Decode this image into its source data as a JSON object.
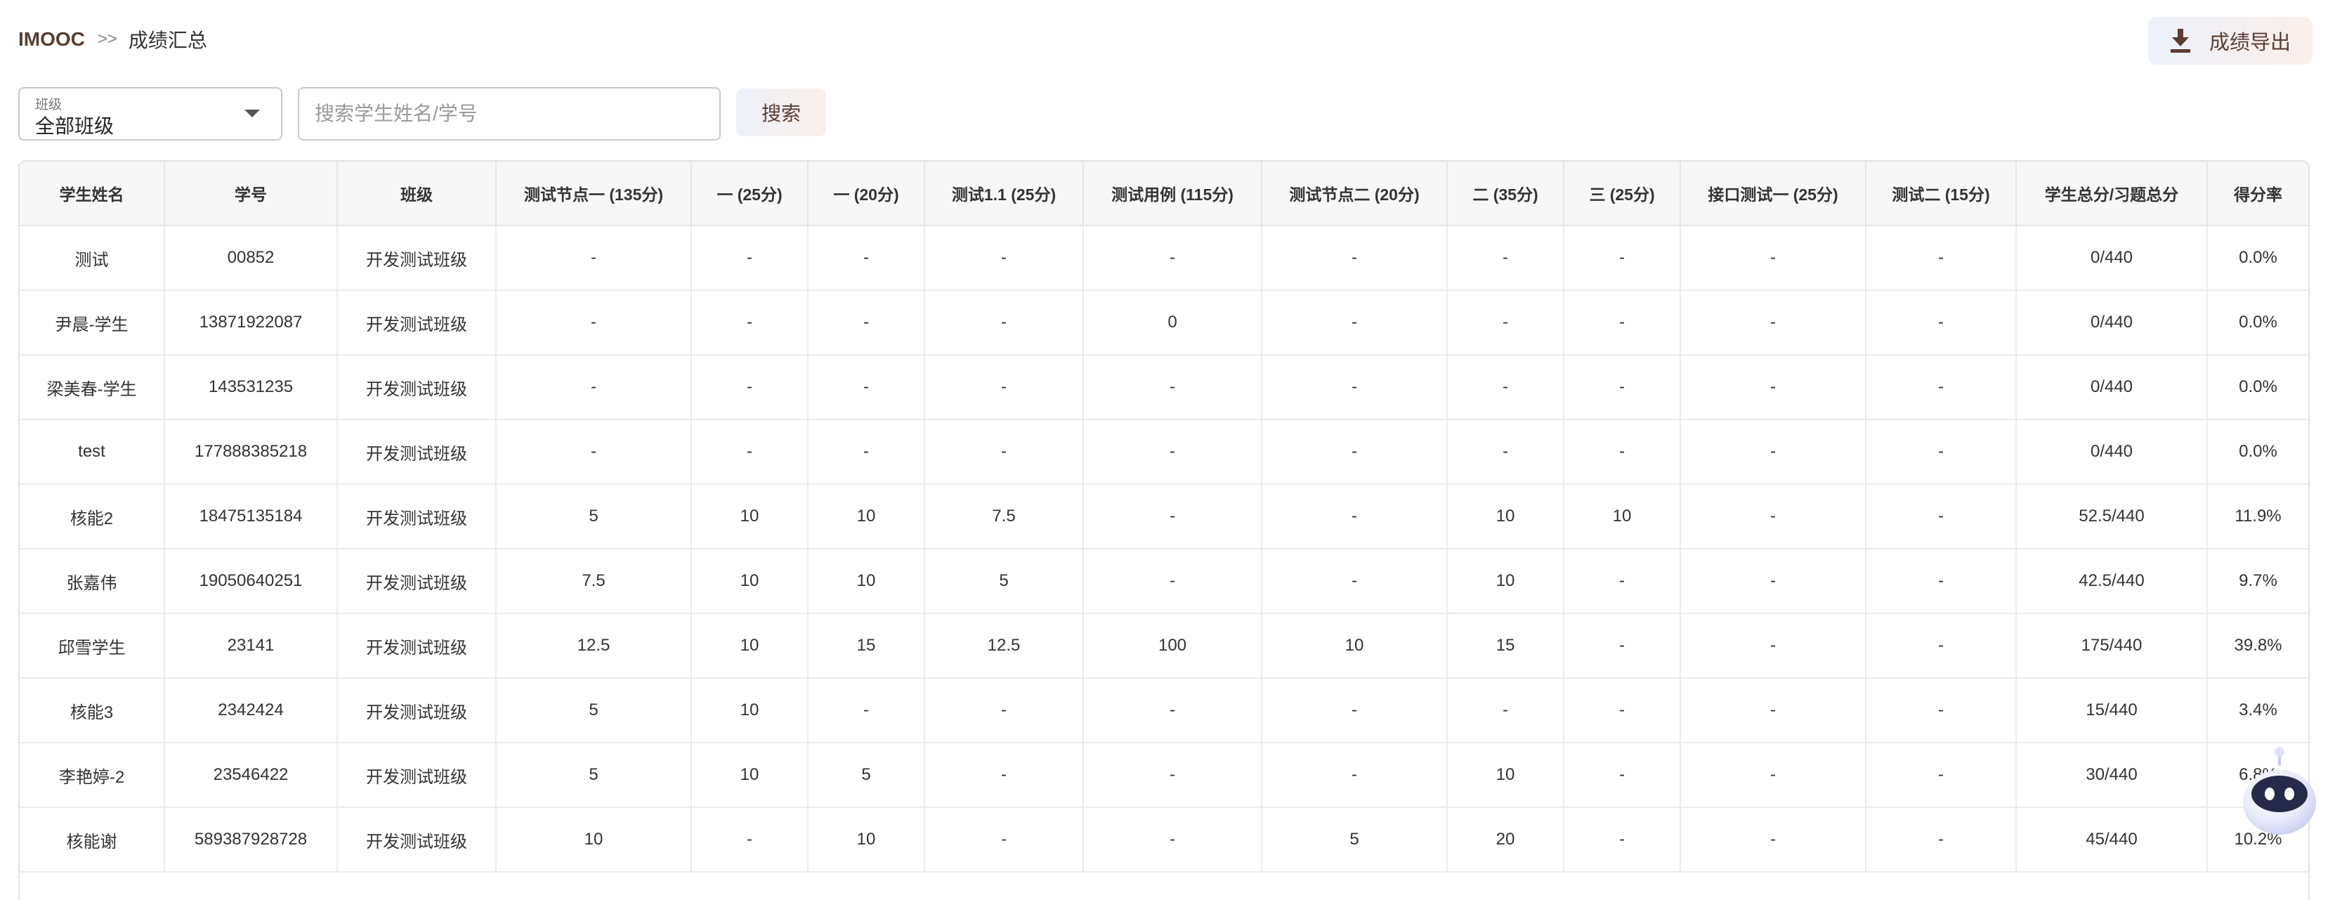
{
  "breadcrumb": {
    "brand": "IMOOC",
    "separator": ">>",
    "current": "成绩汇总"
  },
  "export_button": {
    "label": "成绩导出",
    "icon": "download-icon"
  },
  "filters": {
    "class_label": "班级",
    "class_value": "全部班级",
    "search_placeholder": "搜索学生姓名/学号",
    "search_button": "搜索"
  },
  "table": {
    "headers": [
      "学生姓名",
      "学号",
      "班级",
      "测试节点一 (135分)",
      "一 (25分)",
      "一 (20分)",
      "测试1.1 (25分)",
      "测试用例 (115分)",
      "测试节点二 (20分)",
      "二 (35分)",
      "三 (25分)",
      "接口测试一 (25分)",
      "测试二 (15分)",
      "学生总分/习题总分",
      "得分率"
    ],
    "rows": [
      [
        "测试",
        "00852",
        "开发测试班级",
        "-",
        "-",
        "-",
        "-",
        "-",
        "-",
        "-",
        "-",
        "-",
        "-",
        "0/440",
        "0.0%"
      ],
      [
        "尹晨-学生",
        "13871922087",
        "开发测试班级",
        "-",
        "-",
        "-",
        "-",
        "0",
        "-",
        "-",
        "-",
        "-",
        "-",
        "0/440",
        "0.0%"
      ],
      [
        "梁美春-学生",
        "143531235",
        "开发测试班级",
        "-",
        "-",
        "-",
        "-",
        "-",
        "-",
        "-",
        "-",
        "-",
        "-",
        "0/440",
        "0.0%"
      ],
      [
        "test",
        "177888385218",
        "开发测试班级",
        "-",
        "-",
        "-",
        "-",
        "-",
        "-",
        "-",
        "-",
        "-",
        "-",
        "0/440",
        "0.0%"
      ],
      [
        "核能2",
        "18475135184",
        "开发测试班级",
        "5",
        "10",
        "10",
        "7.5",
        "-",
        "-",
        "10",
        "10",
        "-",
        "-",
        "52.5/440",
        "11.9%"
      ],
      [
        "张嘉伟",
        "19050640251",
        "开发测试班级",
        "7.5",
        "10",
        "10",
        "5",
        "-",
        "-",
        "10",
        "-",
        "-",
        "-",
        "42.5/440",
        "9.7%"
      ],
      [
        "邱雪学生",
        "23141",
        "开发测试班级",
        "12.5",
        "10",
        "15",
        "12.5",
        "100",
        "10",
        "15",
        "-",
        "-",
        "-",
        "175/440",
        "39.8%"
      ],
      [
        "核能3",
        "2342424",
        "开发测试班级",
        "5",
        "10",
        "-",
        "-",
        "-",
        "-",
        "-",
        "-",
        "-",
        "-",
        "15/440",
        "3.4%"
      ],
      [
        "李艳婷-2",
        "23546422",
        "开发测试班级",
        "5",
        "10",
        "5",
        "-",
        "-",
        "-",
        "10",
        "-",
        "-",
        "-",
        "30/440",
        "6.8%"
      ],
      [
        "核能谢",
        "589387928728",
        "开发测试班级",
        "10",
        "-",
        "10",
        "-",
        "-",
        "5",
        "20",
        "-",
        "-",
        "-",
        "45/440",
        "10.2%"
      ]
    ]
  },
  "assistant": {
    "icon": "robot-assistant-icon"
  }
}
